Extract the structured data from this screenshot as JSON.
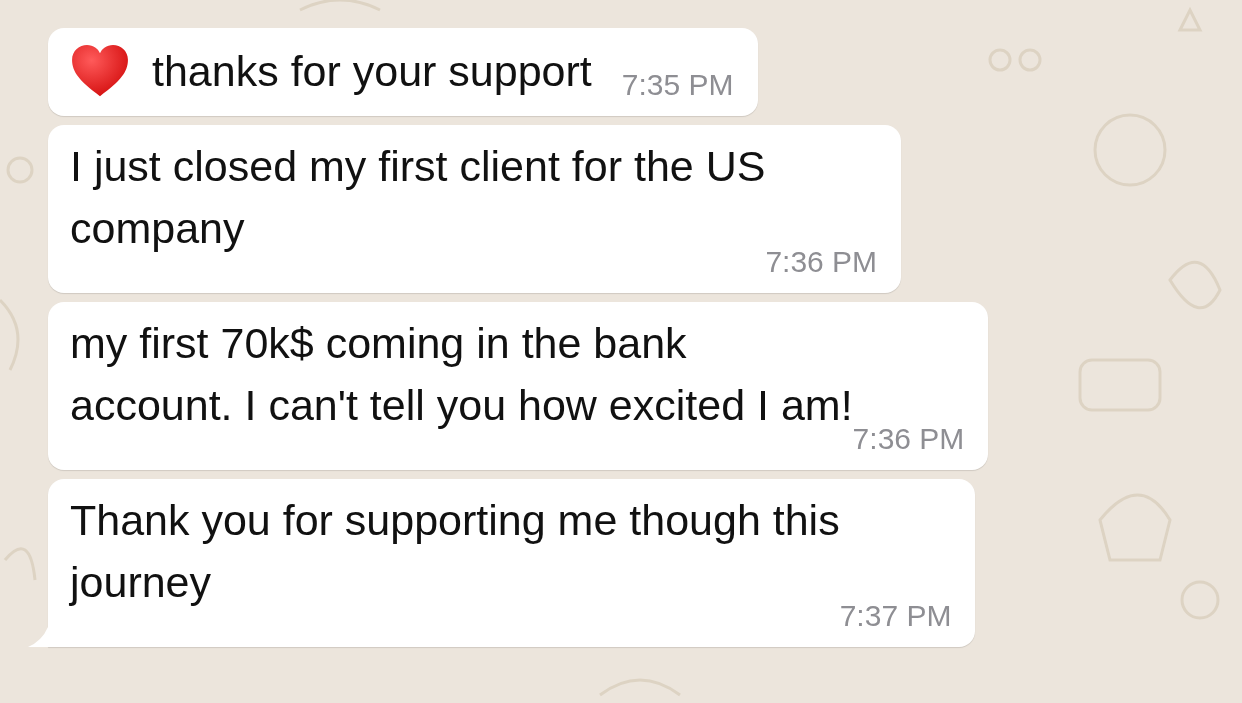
{
  "messages": [
    {
      "kind": "emoji",
      "text": "thanks for your support",
      "time": "7:35 PM",
      "tail": false
    },
    {
      "kind": "plain",
      "text": "I just closed my first client for the US\ncompany",
      "time": "7:36 PM",
      "tail": false
    },
    {
      "kind": "plain",
      "text": "my first 70k$ coming in the bank\naccount. I can't tell you how excited I am!",
      "time": "7:36 PM",
      "tail": false
    },
    {
      "kind": "plain",
      "text": "Thank you for supporting me though this\njourney",
      "time": "7:37 PM",
      "tail": true
    }
  ]
}
